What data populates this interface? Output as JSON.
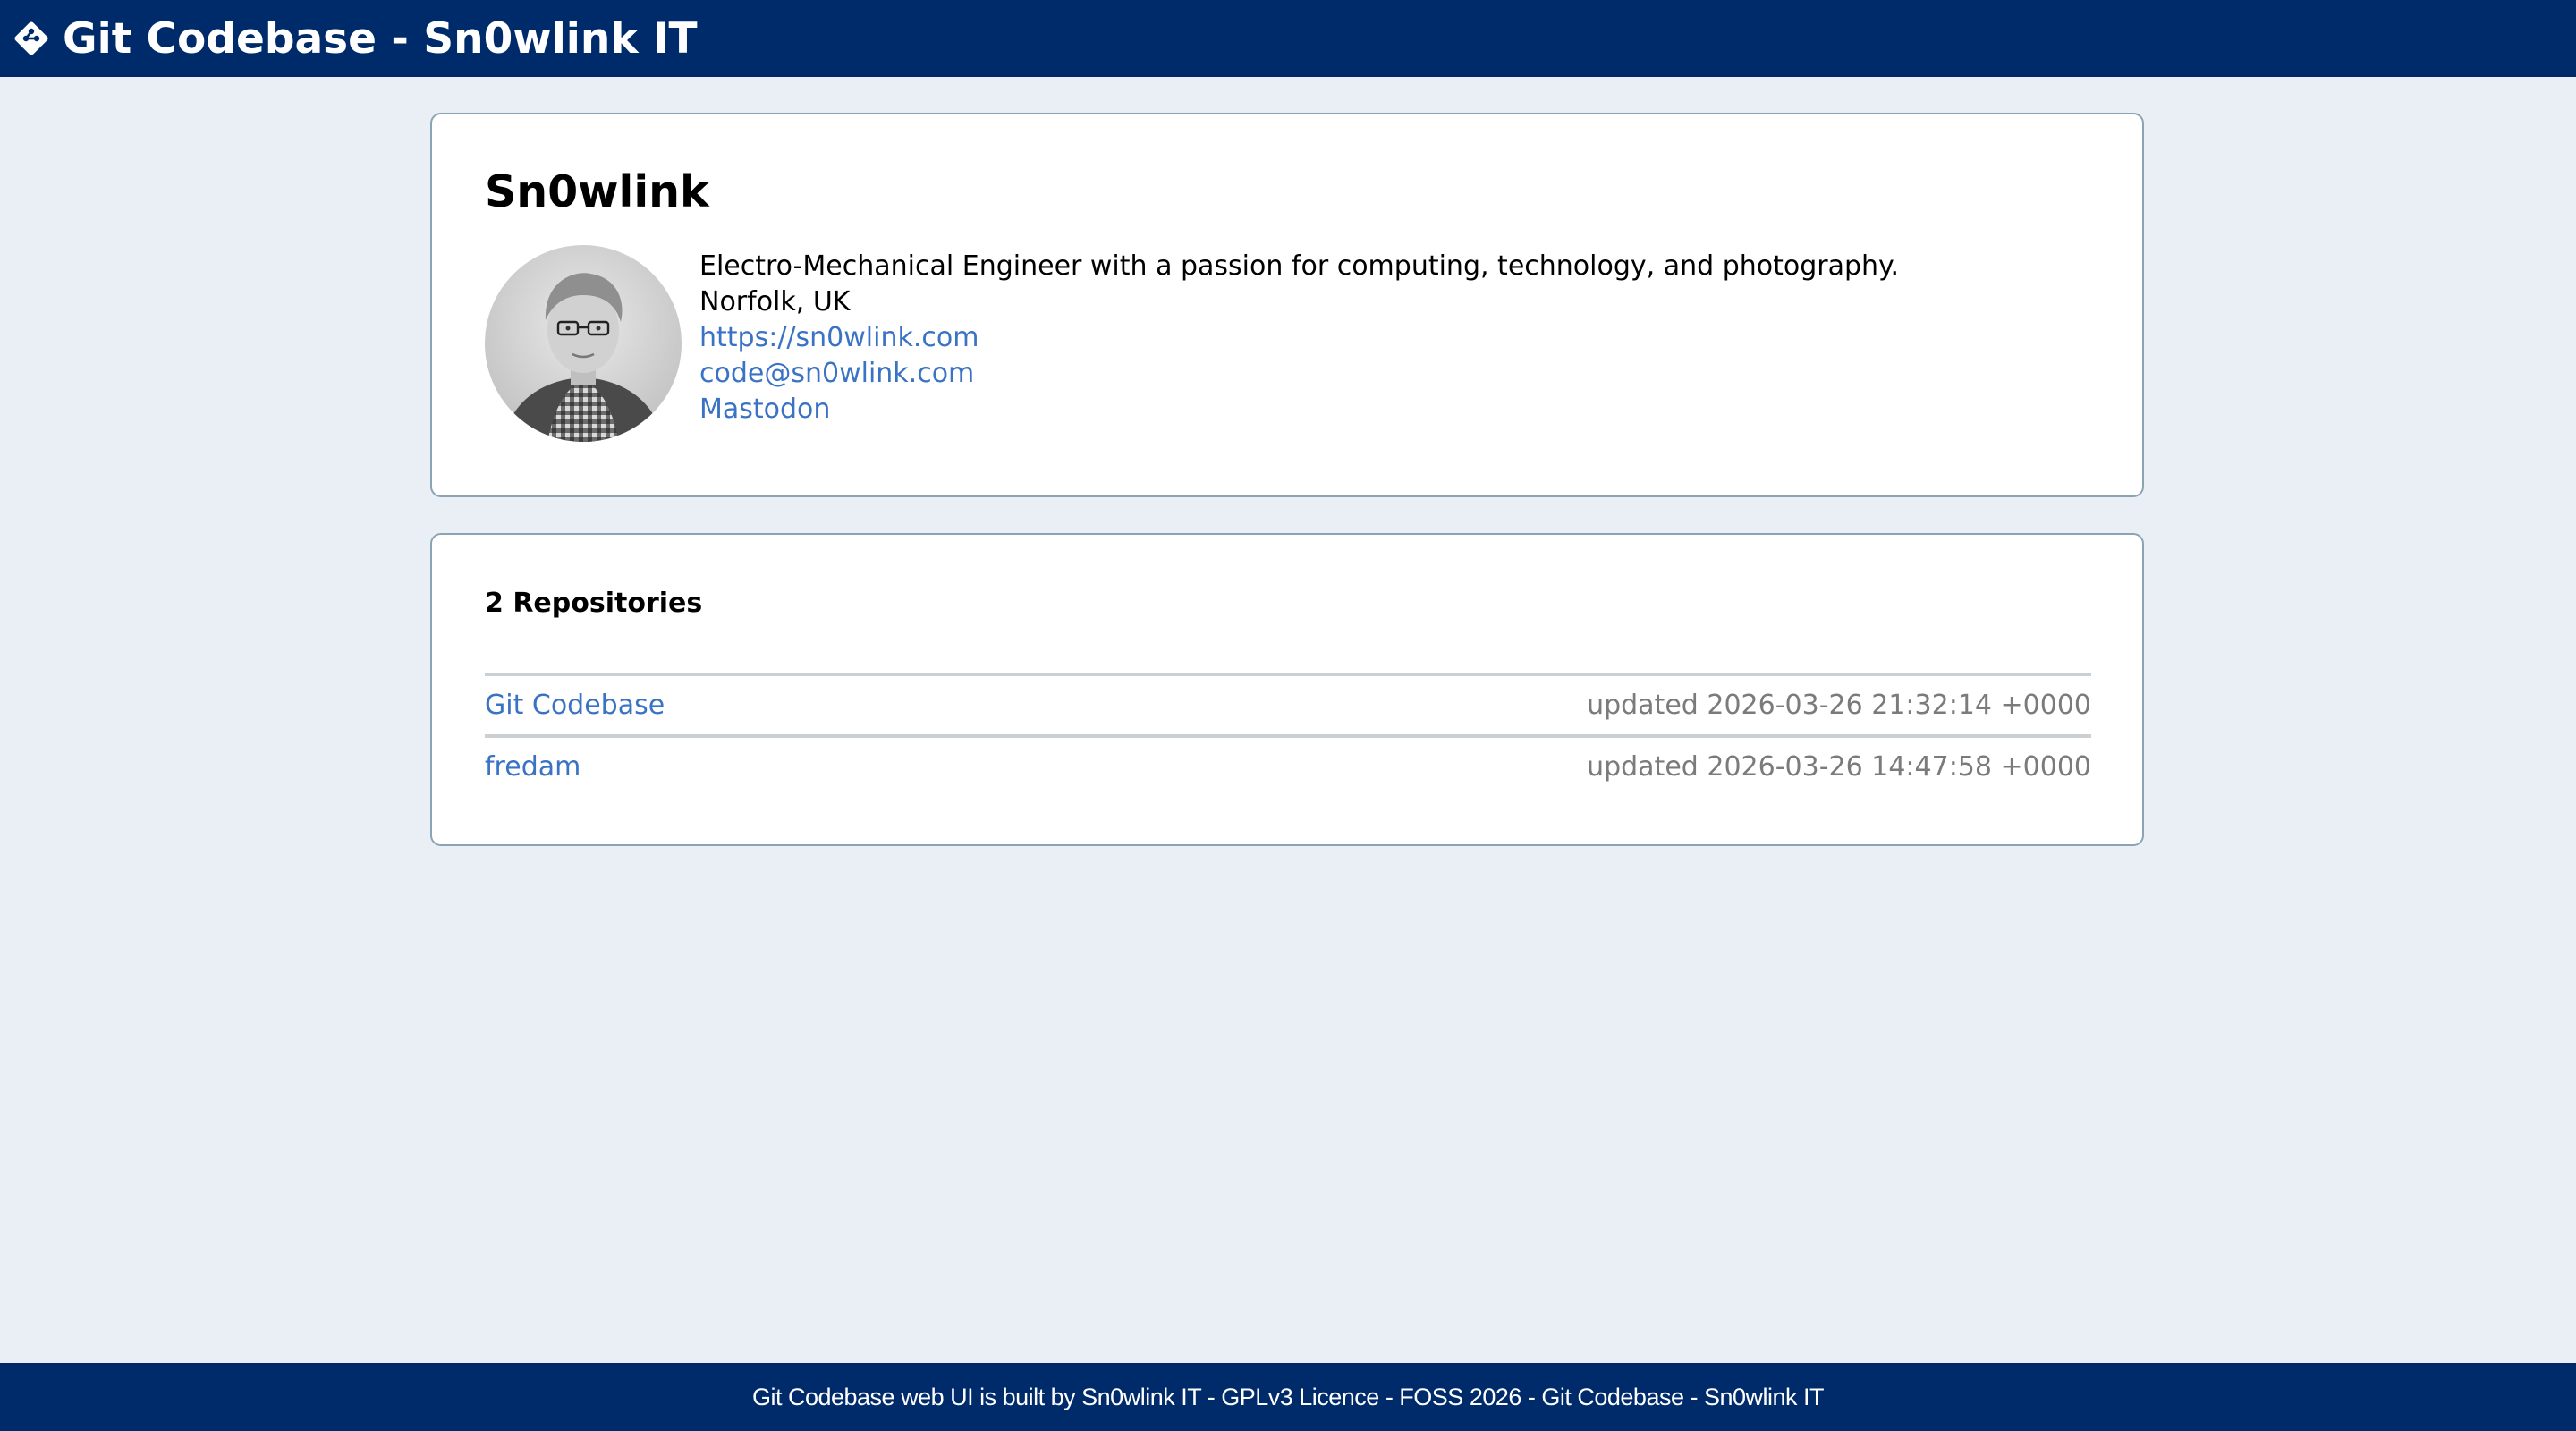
{
  "header": {
    "title": "Git Codebase - Sn0wlink IT",
    "logo_icon": "git-logo-icon"
  },
  "profile": {
    "name": "Sn0wlink",
    "bio": "Electro-Mechanical Engineer with a passion for computing, technology, and photography.",
    "location": "Norfolk, UK",
    "website": "https://sn0wlink.com",
    "email": "code@sn0wlink.com",
    "social": "Mastodon",
    "avatar_alt": "avatar-photo"
  },
  "repositories": {
    "heading": "2 Repositories",
    "items": [
      {
        "name": "Git Codebase",
        "updated": "updated 2026-03-26 21:32:14 +0000"
      },
      {
        "name": "fredam",
        "updated": "updated 2026-03-26 14:47:58 +0000"
      }
    ]
  },
  "footer": {
    "text": "Git Codebase web UI is built by Sn0wlink IT - GPLv3 Licence - FOSS 2026 - Git Codebase - Sn0wlink IT"
  },
  "colors": {
    "header_bg": "#002b6b",
    "page_bg": "#eaeef5",
    "link": "#3a73c4",
    "muted": "#7b7b7b",
    "card_border": "#8aa4b4"
  }
}
